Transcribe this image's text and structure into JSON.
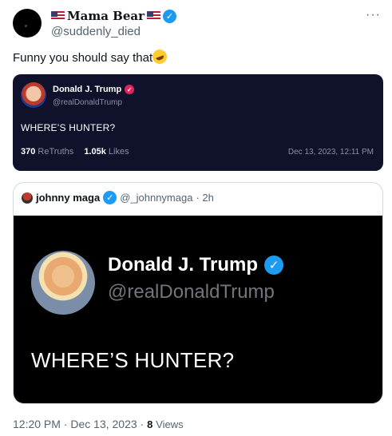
{
  "tweet": {
    "author_name": "Mama Bear",
    "author_handle": "@suddenly_died",
    "more_label": "···",
    "text": "Funny you should say that"
  },
  "truth_card": {
    "name": "Donald J. Trump",
    "handle": "@realDonaldTrump",
    "text": "WHERE’S HUNTER?",
    "retruths_count": "370",
    "retruths_label": "ReTruths",
    "likes_count": "1.05k",
    "likes_label": "Likes",
    "date": "Dec 13, 2023, 12:11 PM"
  },
  "quote": {
    "name": "johnny maga",
    "handle": "@_johnnymaga",
    "time": "· 2h",
    "image": {
      "name": "Donald J. Trump",
      "handle": "@realDonaldTrump",
      "text": "WHERE’S HUNTER?"
    }
  },
  "meta": {
    "timestamp": "12:20 PM · Dec 13, 2023 · ",
    "views_count": "8",
    "views_label": "Views"
  },
  "colors": {
    "verified_blue": "#1d9bf0",
    "truth_bg": "#10112a",
    "truth_badge": "#e0245e"
  },
  "icons": [
    "us-flag-icon",
    "verified-badge-icon",
    "more-icon",
    "rolling-laughing-emoji-icon"
  ]
}
